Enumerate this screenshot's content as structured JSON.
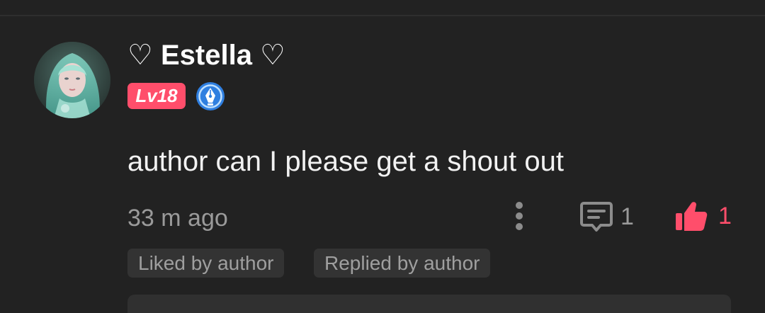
{
  "comment": {
    "username": "♡ Estella ♡",
    "level": "Lv18",
    "text": "author can I please get a shout out",
    "timestamp": "33 m ago",
    "reply_count": "1",
    "like_count": "1",
    "tags": [
      "Liked by author",
      "Replied by author"
    ]
  },
  "icons": {
    "avatar": "user-avatar",
    "badge": "pen-nib-badge-icon",
    "more": "more-vertical-icon",
    "reply": "comment-bubble-icon",
    "like": "thumbs-up-icon"
  },
  "colors": {
    "background": "#222222",
    "accent": "#ff4e6b",
    "muted_text": "#9a9a9a",
    "tag_background": "#333333",
    "badge_blue": "#2f7fe0"
  }
}
